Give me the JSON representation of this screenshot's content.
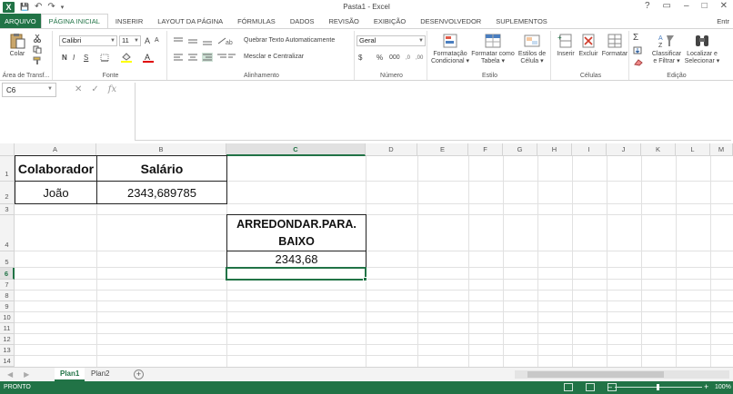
{
  "window": {
    "title": "Pasta1 - Excel",
    "help": "?",
    "controls": [
      "▭",
      "–",
      "□",
      "✕"
    ]
  },
  "quick_access": {
    "save": "💾",
    "undo": "↶",
    "redo": "↷",
    "customize": "▾"
  },
  "ribbon_tabs": [
    "ARQUIVO",
    "PÁGINA INICIAL",
    "INSERIR",
    "LAYOUT DA PÁGINA",
    "FÓRMULAS",
    "DADOS",
    "REVISÃO",
    "EXIBIÇÃO",
    "DESENVOLVEDOR",
    "SUPLEMENTOS"
  ],
  "user": "Entr",
  "ribbon": {
    "clipboard": {
      "paste": "Colar",
      "label": "Área de Transf..."
    },
    "font": {
      "name": "Calibri",
      "size": "11",
      "bold": "N",
      "italic": "I",
      "underline": "S",
      "grow": "A",
      "shrink": "A",
      "label": "Fonte"
    },
    "alignment": {
      "wrap": "Quebrar Texto Automaticamente",
      "merge": "Mesclar e Centralizar",
      "label": "Alinhamento"
    },
    "number": {
      "format": "Geral",
      "currency": "$",
      "percent": "%",
      "thousands": "000",
      "label": "Número"
    },
    "styles": {
      "conditional_line1": "Formatação",
      "conditional_line2": "Condicional",
      "table_line1": "Formatar como",
      "table_line2": "Tabela",
      "cell_styles_line1": "Estilos de",
      "cell_styles_line2": "Célula",
      "label": "Estilo"
    },
    "cells": {
      "insert": "Inserir",
      "delete": "Excluir",
      "format": "Formatar",
      "label": "Células"
    },
    "editing": {
      "sort_line1": "Classificar",
      "sort_line2": "e Filtrar",
      "find_line1": "Localizar e",
      "find_line2": "Selecionar",
      "label": "Edição"
    }
  },
  "formula_bar": {
    "name_box": "C6",
    "cancel": "✕",
    "enter": "✓",
    "fx": "fx",
    "content": ""
  },
  "columns": [
    "A",
    "B",
    "C",
    "D",
    "E",
    "F",
    "G",
    "H",
    "I",
    "J",
    "K",
    "L",
    "M"
  ],
  "rows": [
    "1",
    "2",
    "3",
    "4",
    "5",
    "6",
    "7",
    "8",
    "9",
    "10",
    "11",
    "12",
    "13",
    "14"
  ],
  "selected": {
    "column": "C",
    "row": "6"
  },
  "cells": {
    "A1": "Colaborador",
    "B1": "Salário",
    "A2": "João",
    "B2": "2343,689785",
    "C4_line1": "ARREDONDAR.PARA.",
    "C4_line2": "BAIXO",
    "C5": "2343,68"
  },
  "sheets": [
    "Plan1",
    "Plan2"
  ],
  "active_sheet": "Plan1",
  "status": {
    "ready": "PRONTO",
    "zoom": "100%"
  }
}
